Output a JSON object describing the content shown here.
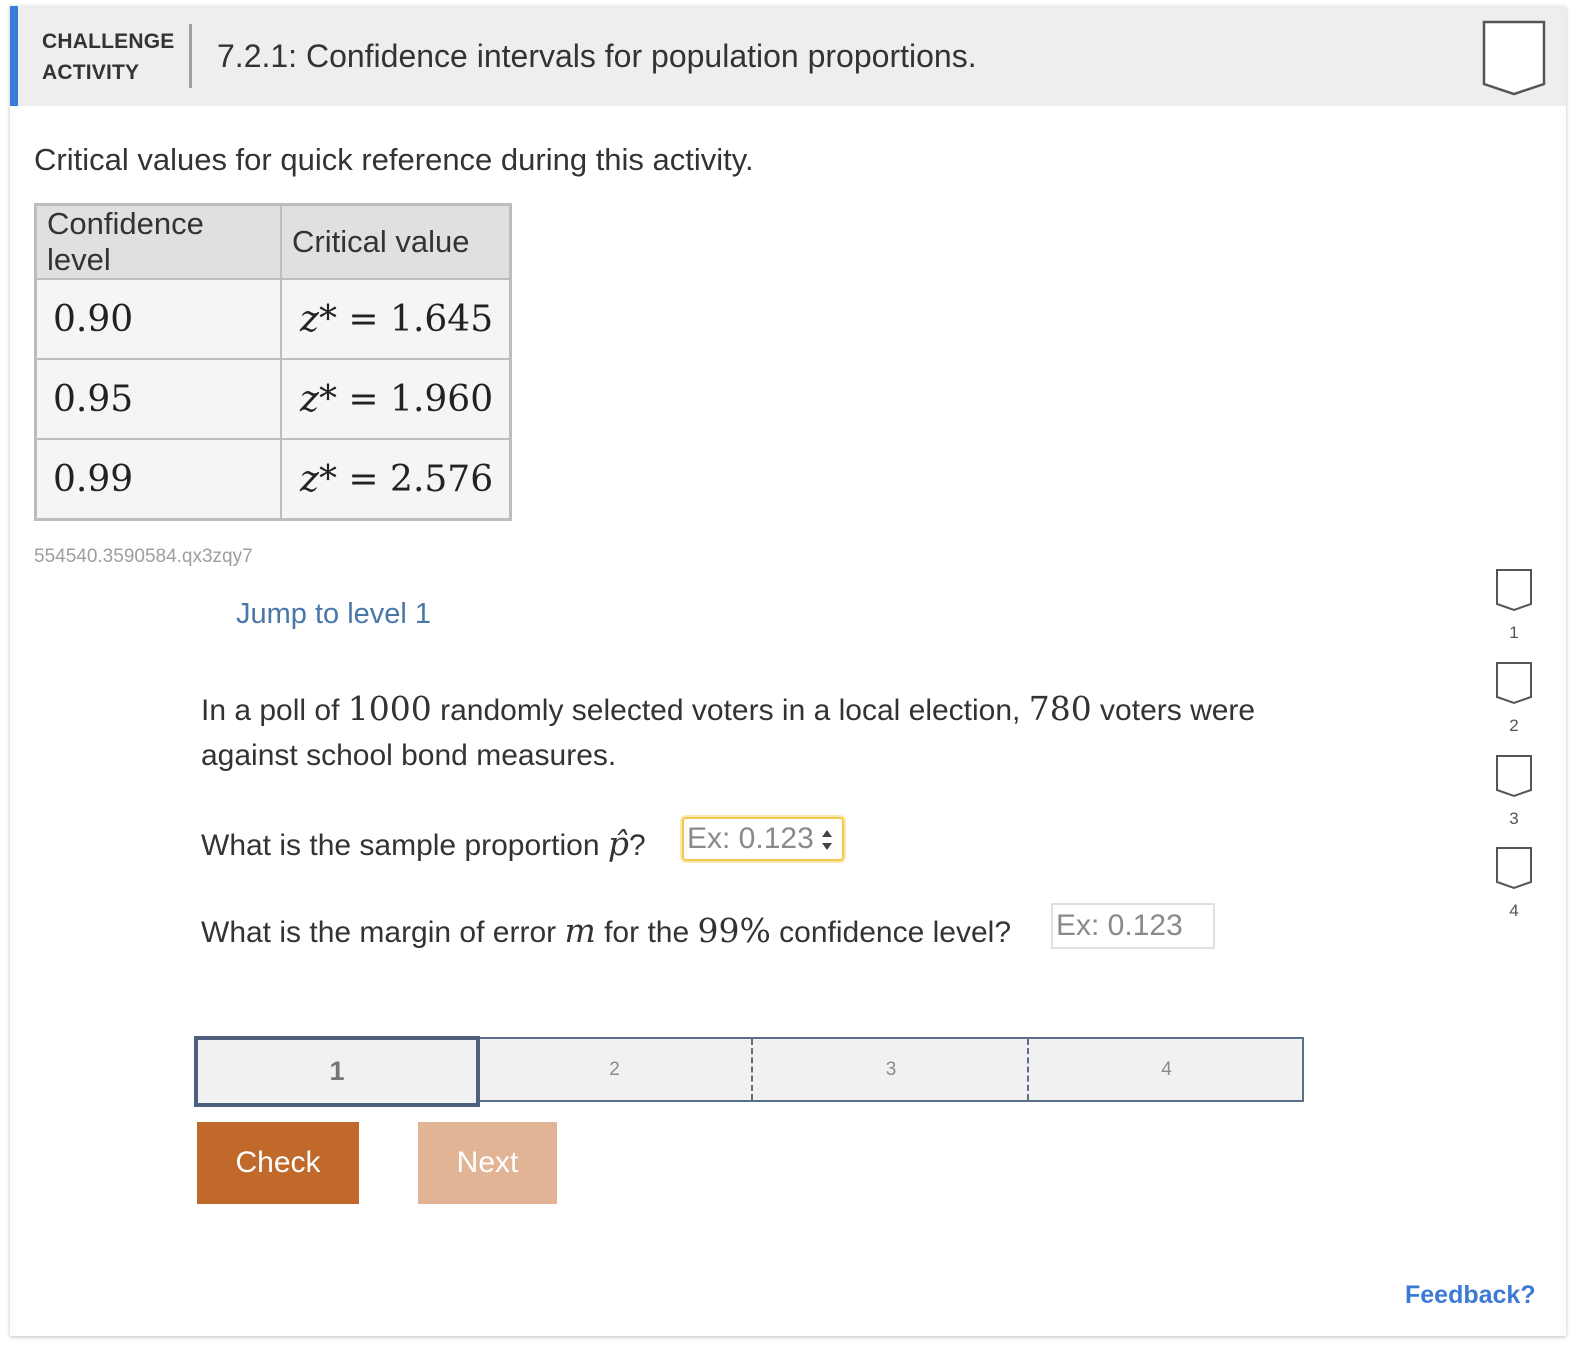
{
  "header": {
    "label_line1": "CHALLENGE",
    "label_line2": "ACTIVITY",
    "title": "7.2.1: Confidence intervals for population proportions."
  },
  "intro": "Critical values for quick reference during this activity.",
  "reference_table": {
    "headers": [
      "Confidence level",
      "Critical value"
    ],
    "rows": [
      {
        "level": "0.90",
        "z": "z*",
        "eq": "=",
        "value": "1.645"
      },
      {
        "level": "0.95",
        "z": "z*",
        "eq": "=",
        "value": "1.960"
      },
      {
        "level": "0.99",
        "z": "z*",
        "eq": "=",
        "value": "2.576"
      }
    ]
  },
  "activity_id": "554540.3590584.qx3zqy7",
  "jump_link": "Jump to level 1",
  "problem": {
    "p1": "In a poll of ",
    "n": "1000",
    "p2": " randomly selected voters in a local election, ",
    "x": "780",
    "p3": " voters were against school bond measures."
  },
  "question1": {
    "text": "What is the sample proportion ",
    "symbol": "p̂",
    "qmark": "?",
    "placeholder": "Ex: 0.123"
  },
  "question2": {
    "text_before": "What is the margin of error ",
    "symbol": "m",
    "text_mid": " for the ",
    "pct": "99%",
    "text_after": " confidence level?",
    "placeholder": "Ex: 0.123"
  },
  "levels": [
    "1",
    "2",
    "3",
    "4"
  ],
  "buttons": {
    "check": "Check",
    "next": "Next"
  },
  "side_levels": [
    "1",
    "2",
    "3",
    "4"
  ],
  "feedback": "Feedback?",
  "colors": {
    "accent": "#3d7bd8",
    "check": "#c1692a",
    "next": "#e0b494",
    "link": "#4a76a8",
    "feedback": "#3c7ad4"
  }
}
